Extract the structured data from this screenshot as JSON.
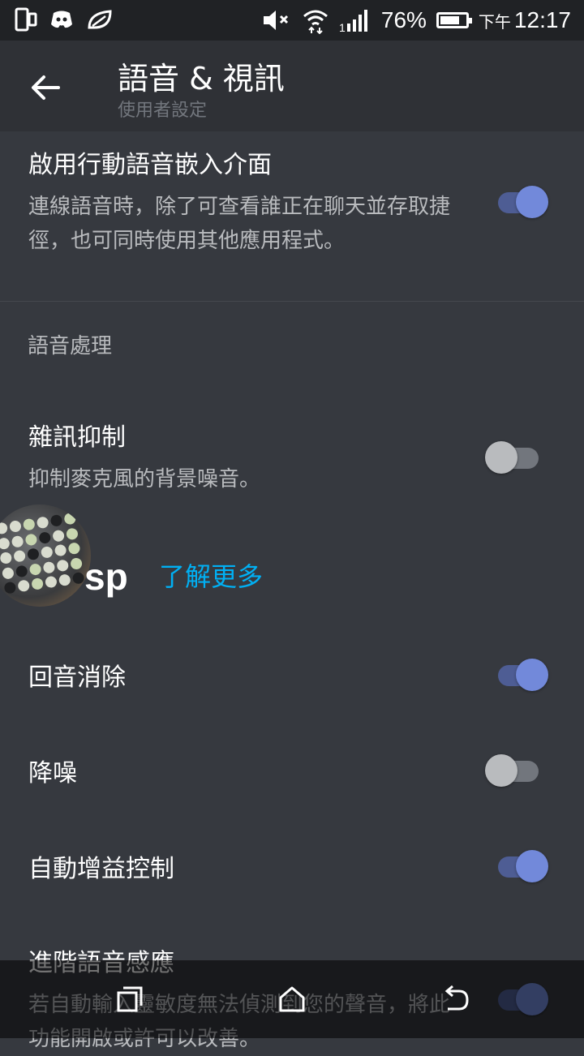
{
  "status_bar": {
    "battery_percent": "76%",
    "battery_level": 0.76,
    "ampm": "下午",
    "time": "12:17",
    "icons": [
      "phone-screen-icon",
      "discord-icon",
      "leaf-icon",
      "mute-icon",
      "wifi-icon",
      "signal-icon"
    ]
  },
  "header": {
    "title": "語音 & 視訊",
    "subtitle": "使用者設定"
  },
  "settings": {
    "overlay": {
      "title": "啟用行動語音嵌入介面",
      "desc": "連線語音時，除了可查看誰正在聊天並存取捷徑，也可同時使用其他應用程式。",
      "enabled": true
    },
    "section_label": "語音處理",
    "noise_suppression": {
      "title": "雜訊抑制",
      "desc": "抑制麥克風的背景噪音。",
      "enabled": false
    },
    "learn_more": "了解更多",
    "brand": "sp",
    "echo_cancellation": {
      "title": "回音消除",
      "enabled": true
    },
    "noise_reduction": {
      "title": "降噪",
      "enabled": false
    },
    "auto_gain": {
      "title": "自動增益控制",
      "enabled": true
    },
    "advanced_voice": {
      "title": "進階語音感應",
      "desc": "若自動輸入靈敏度無法偵測到您的聲音，將此功能開啟或許可以改善。",
      "enabled": true
    }
  },
  "colors": {
    "accent": "#7289da",
    "link": "#00b0f4",
    "background": "#36393f",
    "header": "#2f3136"
  }
}
